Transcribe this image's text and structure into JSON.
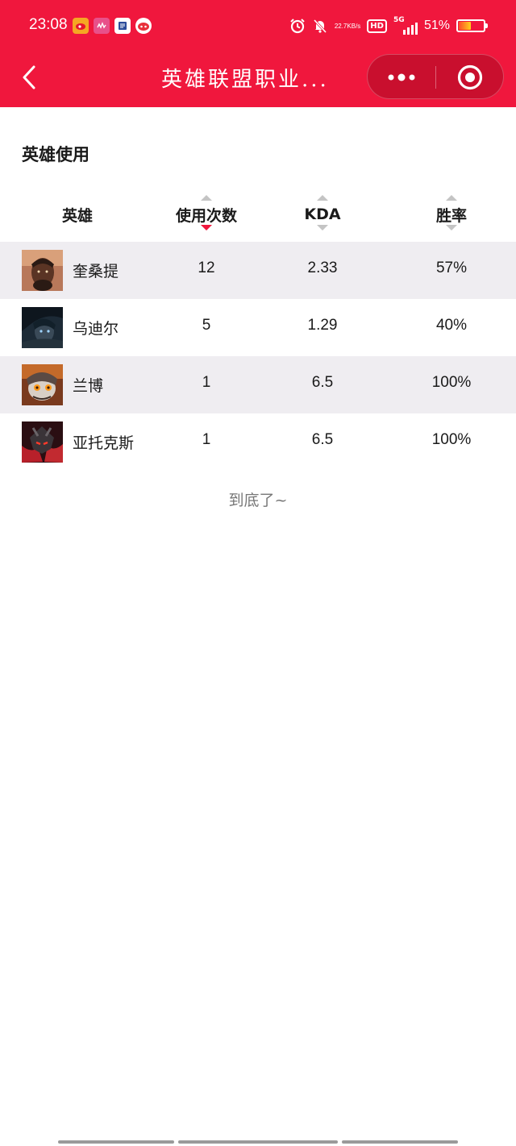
{
  "status_bar": {
    "time": "23:08",
    "speed_value": "22.7",
    "speed_unit": "KB/s",
    "hd_label": "HD",
    "network_label": "5G",
    "battery_percent": "51%",
    "battery_level": 0.51,
    "apps": [
      {
        "icon": "weibo-app-icon",
        "color": "#f5a623"
      },
      {
        "icon": "music-app-icon",
        "color": "#e8508a"
      },
      {
        "icon": "reader-app-icon",
        "color": "#ffffff"
      },
      {
        "icon": "mascot-app-icon",
        "color": "#ffffff"
      }
    ]
  },
  "nav": {
    "title": "英雄联盟职业..."
  },
  "section": {
    "title": "英雄使用"
  },
  "table": {
    "headers": {
      "hero": "英雄",
      "uses": "使用次数",
      "kda": "KDA",
      "winrate": "胜率"
    },
    "active_sort": "uses",
    "rows": [
      {
        "hero": "奎桑提",
        "uses": "12",
        "kda": "2.33",
        "winrate": "57%"
      },
      {
        "hero": "乌迪尔",
        "uses": "5",
        "kda": "1.29",
        "winrate": "40%"
      },
      {
        "hero": "兰博",
        "uses": "1",
        "kda": "6.5",
        "winrate": "100%"
      },
      {
        "hero": "亚托克斯",
        "uses": "1",
        "kda": "6.5",
        "winrate": "100%"
      }
    ]
  },
  "footer": {
    "end_text": "到底了~"
  },
  "colors": {
    "brand_red": "#f0173d",
    "row_shade": "#efedf1",
    "sort_inactive": "#c4c4c4"
  }
}
